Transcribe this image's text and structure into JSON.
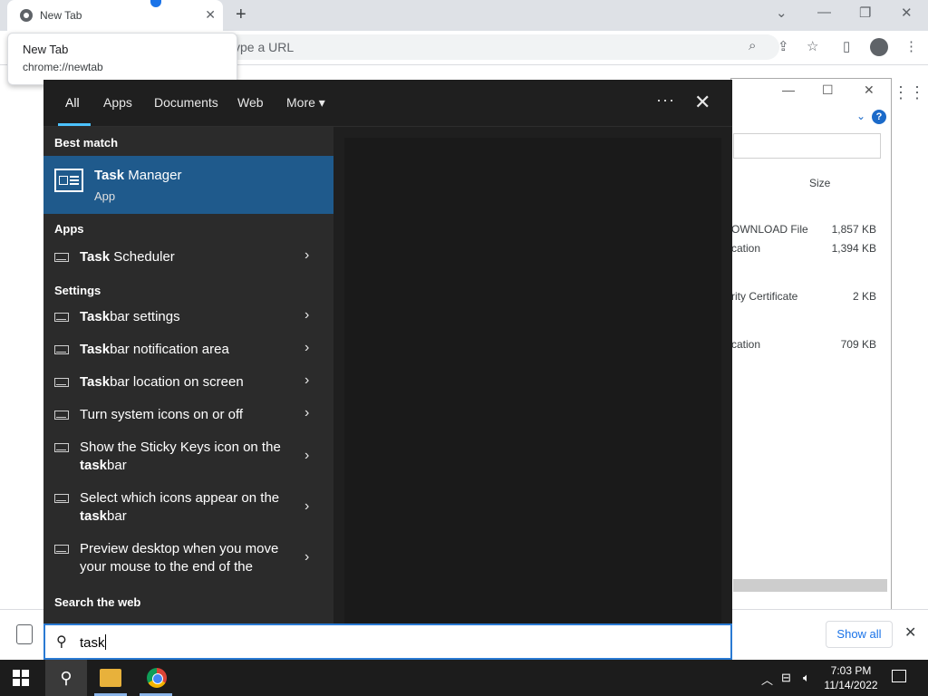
{
  "browser": {
    "tab_title": "New Tab",
    "address_placeholder": "ype a URL",
    "tooltip_title": "New Tab",
    "tooltip_url": "chrome://newtab"
  },
  "explorer_bg": {
    "size_header": "Size",
    "rows": [
      {
        "type": "OWNLOAD File",
        "size": "1,857 KB"
      },
      {
        "type": "cation",
        "size": "1,394 KB"
      },
      {
        "type": "rity Certificate",
        "size": "2 KB"
      },
      {
        "type": "cation",
        "size": "709 KB"
      }
    ],
    "help_label": "?"
  },
  "search": {
    "tabs": [
      "All",
      "Apps",
      "Documents",
      "Web",
      "More"
    ],
    "more_caret": "▾",
    "dots": "···",
    "close": "✕",
    "best_match_header": "Best match",
    "best_match": {
      "name_bold": "Task",
      "name_rest": " Manager",
      "subtitle": "App"
    },
    "apps_header": "Apps",
    "apps": [
      {
        "bold": "Task",
        "rest": " Scheduler"
      }
    ],
    "settings_header": "Settings",
    "settings": [
      {
        "pre": "",
        "bold": "Task",
        "rest": "bar settings",
        "line2_bold": "",
        "line2_rest": ""
      },
      {
        "pre": "",
        "bold": "Task",
        "rest": "bar notification area",
        "line2_bold": "",
        "line2_rest": ""
      },
      {
        "pre": "",
        "bold": "Task",
        "rest": "bar location on screen",
        "line2_bold": "",
        "line2_rest": ""
      },
      {
        "pre": "Turn system icons on or off",
        "bold": "",
        "rest": "",
        "line2_bold": "",
        "line2_rest": ""
      },
      {
        "pre": "Show the Sticky Keys icon on the ",
        "bold": "",
        "rest": "",
        "line2_bold": "task",
        "line2_rest": "bar"
      },
      {
        "pre": "Select which icons appear on the ",
        "bold": "",
        "rest": "",
        "line2_bold": "task",
        "line2_rest": "bar"
      },
      {
        "pre": "Preview desktop when you move your mouse to the end of the",
        "bold": "",
        "rest": "",
        "line2_bold": "",
        "line2_rest": ""
      }
    ],
    "web_header": "Search the web",
    "query": "task",
    "chevron": "›"
  },
  "download_bar": {
    "show_all": "Show all",
    "close": "✕"
  },
  "taskbar": {
    "time": "7:03 PM",
    "date": "11/14/2022"
  },
  "colors": {
    "accent": "#1f5a8c",
    "search_border": "#2a7ad3",
    "tab_underline": "#4cc2ff"
  }
}
